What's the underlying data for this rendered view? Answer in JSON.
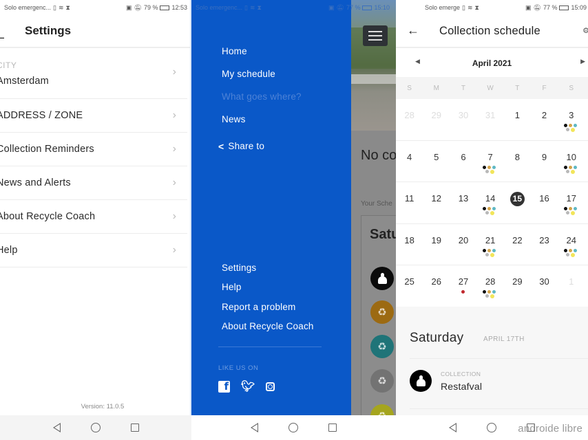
{
  "settings_screen": {
    "status": {
      "left": "Solo emergenc...",
      "battery": "79 %",
      "time": "12:53"
    },
    "title": "Settings",
    "items": [
      {
        "small_label": "CITY",
        "label": "Amsterdam"
      },
      {
        "label": "ADDRESS / ZONE"
      },
      {
        "label": "Collection Reminders"
      },
      {
        "label": "News and Alerts"
      },
      {
        "label": "About Recycle Coach"
      },
      {
        "label": "Help"
      }
    ],
    "version": "Version: 11.0.5"
  },
  "drawer_screen": {
    "status": {
      "left": "Solo emergenc...",
      "battery": "77 %",
      "time": "15:10"
    },
    "menu": [
      {
        "label": "Home",
        "enabled": true
      },
      {
        "label": "My schedule",
        "enabled": true
      },
      {
        "label": "What goes where?",
        "enabled": false
      },
      {
        "label": "News",
        "enabled": true
      }
    ],
    "share_label": "Share to",
    "lower_menu": [
      "Settings",
      "Help",
      "Report a problem",
      "About Recycle Coach"
    ],
    "like_us_label": "LIKE US ON",
    "socials": [
      "facebook",
      "twitter",
      "instagram"
    ],
    "background": {
      "headline": "No co",
      "subheading": "Your Sche",
      "card_title": "Satu"
    },
    "accent_color": "#0a58c8"
  },
  "schedule_screen": {
    "status": {
      "left": "Solo emerge",
      "battery": "77 %",
      "time": "15:09"
    },
    "title": "Collection schedule",
    "month": "April 2021",
    "weekdays": [
      "S",
      "M",
      "T",
      "W",
      "T",
      "F",
      "S"
    ],
    "weeks": [
      [
        {
          "d": "28",
          "faded": true
        },
        {
          "d": "29",
          "faded": true
        },
        {
          "d": "30",
          "faded": true
        },
        {
          "d": "31",
          "faded": true
        },
        {
          "d": "1"
        },
        {
          "d": "2"
        },
        {
          "d": "3",
          "dots": "multi"
        }
      ],
      [
        {
          "d": "4"
        },
        {
          "d": "5"
        },
        {
          "d": "6"
        },
        {
          "d": "7",
          "dots": "multi"
        },
        {
          "d": "8"
        },
        {
          "d": "9"
        },
        {
          "d": "10",
          "dots": "multi"
        }
      ],
      [
        {
          "d": "11"
        },
        {
          "d": "12"
        },
        {
          "d": "13"
        },
        {
          "d": "14",
          "dots": "multi"
        },
        {
          "d": "15",
          "today": true
        },
        {
          "d": "16"
        },
        {
          "d": "17",
          "dots": "multi"
        }
      ],
      [
        {
          "d": "18"
        },
        {
          "d": "19"
        },
        {
          "d": "20"
        },
        {
          "d": "21",
          "dots": "multi"
        },
        {
          "d": "22"
        },
        {
          "d": "23"
        },
        {
          "d": "24",
          "dots": "multi"
        }
      ],
      [
        {
          "d": "25"
        },
        {
          "d": "26"
        },
        {
          "d": "27",
          "dots": "red"
        },
        {
          "d": "28",
          "dots": "multi"
        },
        {
          "d": "29"
        },
        {
          "d": "30"
        },
        {
          "d": "1",
          "faded": true
        }
      ]
    ],
    "dot_colors": [
      "#111111",
      "#d4a44a",
      "#5fb8c4",
      "#b8b8b8",
      "#f2e55a"
    ],
    "red_dot_color": "#c0282e",
    "selected_day": "Saturday",
    "selected_date": "APRIL 17TH",
    "collection_kind": "COLLECTION",
    "collection_name": "Restafval",
    "watermark": "androide libre"
  }
}
